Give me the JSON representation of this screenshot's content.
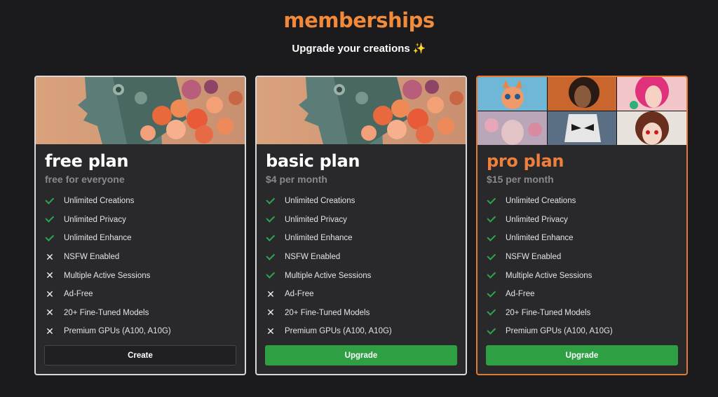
{
  "header": {
    "title": "memberships",
    "subtitle": "Upgrade your creations ✨"
  },
  "colors": {
    "background": "#1b1b1d",
    "card": "#29292c",
    "accent_orange": "#ef7f3c",
    "check_green": "#2ea44f",
    "button_green": "#2ea043"
  },
  "plans": [
    {
      "name": "free plan",
      "price": "free for everyone",
      "button": "Create",
      "features": [
        {
          "label": "Unlimited Creations",
          "included": true
        },
        {
          "label": "Unlimited Privacy",
          "included": true
        },
        {
          "label": "Unlimited Enhance",
          "included": true
        },
        {
          "label": "NSFW Enabled",
          "included": false
        },
        {
          "label": "Multiple Active Sessions",
          "included": false
        },
        {
          "label": "Ad-Free",
          "included": false
        },
        {
          "label": "20+ Fine-Tuned Models",
          "included": false
        },
        {
          "label": "Premium GPUs (A100, A10G)",
          "included": false
        }
      ]
    },
    {
      "name": "basic plan",
      "price": "$4 per month",
      "button": "Upgrade",
      "features": [
        {
          "label": "Unlimited Creations",
          "included": true
        },
        {
          "label": "Unlimited Privacy",
          "included": true
        },
        {
          "label": "Unlimited Enhance",
          "included": true
        },
        {
          "label": "NSFW Enabled",
          "included": true
        },
        {
          "label": "Multiple Active Sessions",
          "included": true
        },
        {
          "label": "Ad-Free",
          "included": false
        },
        {
          "label": "20+ Fine-Tuned Models",
          "included": false
        },
        {
          "label": "Premium GPUs (A100, A10G)",
          "included": false
        }
      ]
    },
    {
      "name": "pro plan",
      "price": "$15 per month",
      "button": "Upgrade",
      "features": [
        {
          "label": "Unlimited Creations",
          "included": true
        },
        {
          "label": "Unlimited Privacy",
          "included": true
        },
        {
          "label": "Unlimited Enhance",
          "included": true
        },
        {
          "label": "NSFW Enabled",
          "included": true
        },
        {
          "label": "Multiple Active Sessions",
          "included": true
        },
        {
          "label": "Ad-Free",
          "included": true
        },
        {
          "label": "20+ Fine-Tuned Models",
          "included": true
        },
        {
          "label": "Premium GPUs (A100, A10G)",
          "included": true
        }
      ]
    }
  ]
}
